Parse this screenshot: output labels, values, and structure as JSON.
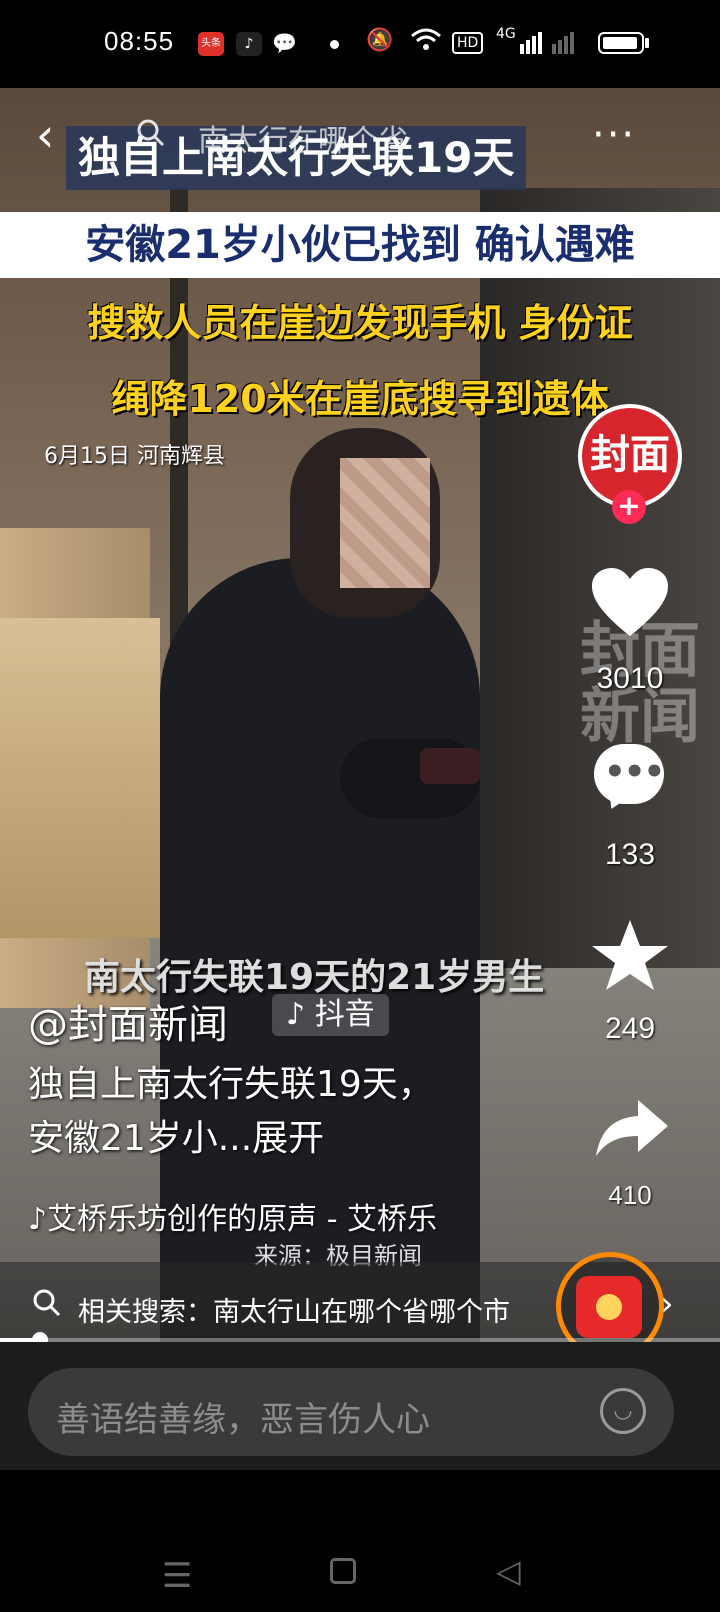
{
  "status_bar": {
    "time": "08:55",
    "toutiao_label": "头条",
    "icons": [
      "toutiao-icon",
      "tiktok-icon",
      "wechat-icon",
      "dot",
      "mute-icon",
      "wifi-icon",
      "hd-icon",
      "signal-4g-icon",
      "signal-icon",
      "battery-icon"
    ],
    "network": "4G",
    "hd": "HD"
  },
  "video": {
    "nav": {
      "back_icon": "‹",
      "search_text": "南太行在哪个省",
      "more_icon": "···"
    },
    "captions": {
      "title": "独自上南太行失联19天",
      "white_banner": "安徽21岁小伙已找到 确认遇难",
      "yellow_line1": "搜救人员在崖边发现手机 身份证",
      "yellow_line2": "绳降120米在崖底搜寻到遗体",
      "date_location": "6月15日 河南辉县",
      "bottom_caption": "南太行失联19天的21岁男生",
      "source": "来源：极目新闻"
    },
    "watermark": "封面新闻"
  },
  "sidebar": {
    "avatar_label": "封面",
    "follow": "+",
    "likes": "3010",
    "comments": "133",
    "favorites": "249",
    "shares": "410"
  },
  "post": {
    "author": "@封面新闻",
    "tag": "抖音",
    "description": "独自上南太行失联19天，安徽21岁小...",
    "expand": "展开",
    "music": "艾桥乐坊创作的原声 - 艾桥乐"
  },
  "related": {
    "label": "相关搜索：南太行山在哪个省哪个市"
  },
  "progress": {
    "fraction": 0.05
  },
  "comment_input": {
    "placeholder": "善语结善缘，恶言伤人心"
  }
}
